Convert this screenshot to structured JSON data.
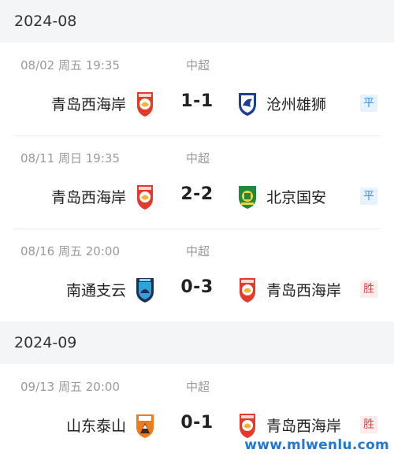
{
  "months": [
    {
      "label": "2024-08",
      "matches": [
        {
          "date": "08/02  周五 19:35",
          "competition": "中超",
          "home": "青岛西海岸",
          "home_logo": "qingdao-logo",
          "score": "1-1",
          "away": "沧州雄狮",
          "away_logo": "cangzhou-logo",
          "result": "平",
          "result_type": "draw"
        },
        {
          "date": "08/11  周日 19:35",
          "competition": "中超",
          "home": "青岛西海岸",
          "home_logo": "qingdao-logo",
          "score": "2-2",
          "away": "北京国安",
          "away_logo": "beijing-logo",
          "result": "平",
          "result_type": "draw"
        },
        {
          "date": "08/16  周五 20:00",
          "competition": "中超",
          "home": "南通支云",
          "home_logo": "nantong-logo",
          "score": "0-3",
          "away": "青岛西海岸",
          "away_logo": "qingdao-logo",
          "result": "胜",
          "result_type": "win"
        }
      ]
    },
    {
      "label": "2024-09",
      "matches": [
        {
          "date": "09/13  周五 20:00",
          "competition": "中超",
          "home": "山东泰山",
          "home_logo": "shandong-logo",
          "score": "0-1",
          "away": "青岛西海岸",
          "away_logo": "qingdao-logo",
          "result": "胜",
          "result_type": "win"
        }
      ]
    }
  ],
  "watermark": "www.mlwenlu.com"
}
